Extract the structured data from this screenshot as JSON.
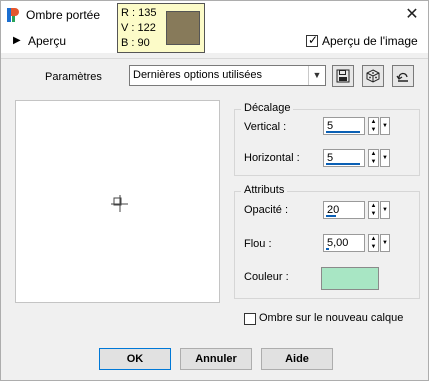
{
  "window": {
    "title": "Ombre portée",
    "preview_section_label": "Aperçu",
    "preview_checkbox_label": "Aperçu de l'image",
    "preview_checked": true
  },
  "color_tooltip": {
    "r_label": "R : 135",
    "v_label": "V : 122",
    "b_label": "B : 90",
    "swatch_color": "#877a5a"
  },
  "params": {
    "label": "Paramètres",
    "selected": "Dernières options utilisées"
  },
  "decalage": {
    "title": "Décalage",
    "vertical_label": "Vertical :",
    "vertical_value": "5",
    "horizontal_label": "Horizontal :",
    "horizontal_value": "5"
  },
  "attributs": {
    "title": "Attributs",
    "opacite_label": "Opacité :",
    "opacite_value": "20",
    "flou_label": "Flou :",
    "flou_value": "5,00",
    "couleur_label": "Couleur :",
    "couleur_color": "#a8e6c4"
  },
  "ombre_checkbox": {
    "label": "Ombre sur le nouveau calque",
    "checked": false
  },
  "buttons": {
    "ok": "OK",
    "cancel": "Annuler",
    "help": "Aide"
  },
  "icons": {
    "app": "paintshop-icon",
    "close": "close-icon",
    "save": "save-icon",
    "randomize": "dice-icon",
    "reset": "reset-icon"
  }
}
